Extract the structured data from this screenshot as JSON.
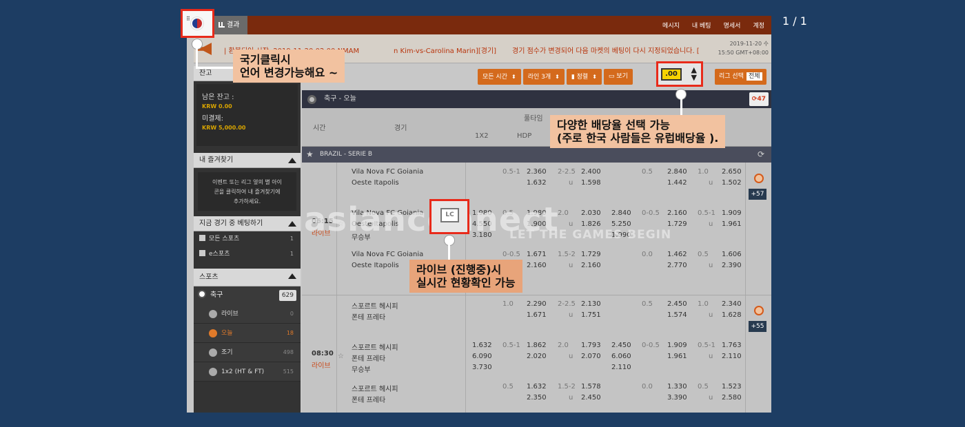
{
  "page_counter": "1 / 1",
  "topbar": {
    "results_tab": "결과",
    "nav": [
      "메시지",
      "내 베팅",
      "명세서",
      "계정"
    ]
  },
  "news": {
    "left": "| 환불되어 시작..2019-11-20 02:00 NMAM",
    "mid": "n Kim-vs-Carolina Marin][경기]",
    "right": "경기 점수가 변경되어 다음 마켓의 베팅이 다시 지정되었습니다. [",
    "date1": "2019-11-20 수",
    "date2": "15:50 GMT+08:00"
  },
  "sidebar": {
    "balance_header": "잔고",
    "balance_label": "남은 잔고 :",
    "balance_value": "KRW 0.00",
    "unsettled_label": "미결제:",
    "unsettled_value": "KRW 5,000.00",
    "fav_header": "내 즐겨찾기",
    "fav_text": [
      "이벤트 또는 리그 옆의 별 아이",
      "콘을 클릭하여 내 즐겨찾기에",
      "추가하세요."
    ],
    "live_header": "지금 경기 중 베팅하기",
    "live_items": [
      {
        "label": "모든 스포츠",
        "count": "1"
      },
      {
        "label": "e스포츠",
        "count": "1"
      }
    ],
    "sports_header": "스포츠",
    "sport": {
      "label": "축구",
      "count": "629"
    },
    "subs": [
      {
        "label": "라이브",
        "count": "0",
        "active": false
      },
      {
        "label": "오늘",
        "count": "18",
        "active": true
      },
      {
        "label": "조기",
        "count": "498",
        "active": false
      },
      {
        "label": "1x2 (HT & FT)",
        "count": "515",
        "active": false
      }
    ]
  },
  "toolbar": {
    "all_time": "모든 시간",
    "lines": "라인 3개",
    "sort": "정렬",
    "view": "보기",
    "odds_value": ".00",
    "league_select": "리그 선택",
    "league_all": "전체"
  },
  "main": {
    "title": "축구 - 오늘",
    "refresh_count": "47",
    "col_time": "시간",
    "col_match": "경기",
    "col_fulltime": "풀타임",
    "col_1x2": "1X2",
    "col_hdp": "HDP",
    "league": "BRAZIL - SERIE B"
  },
  "matches": [
    {
      "time": "06:15",
      "status": "라이브",
      "plus": "+57",
      "rows": [
        {
          "home": "Vila Nova FC Goiania",
          "away": "Oeste Itapolis",
          "draw": "",
          "x": [
            "",
            "",
            ""
          ],
          "hdp": "0.5-1",
          "hdp_odds": [
            "2.360",
            "1.632"
          ],
          "ou": "2-2.5",
          "ou_u": "u",
          "ou_odds": [
            "2.400",
            "1.598"
          ],
          "h_hdp": "0.5",
          "h_hdp_odds": [
            "2.840",
            "1.442"
          ],
          "h_ou": "1.0",
          "h_ou_u": "u",
          "h_ou_odds": [
            "2.650",
            "1.502"
          ],
          "hx": [
            "",
            "",
            ""
          ]
        },
        {
          "home": "Vila Nova FC Goiania",
          "away": "Oeste Itapolis",
          "draw": "무승부",
          "x": [
            "1.980",
            "4.550",
            "3.180"
          ],
          "hdp": "0.5",
          "hdp_odds": [
            "1.980",
            "1.900"
          ],
          "ou": "2.0",
          "ou_u": "u",
          "ou_odds": [
            "2.030",
            "1.826"
          ],
          "h_hdp": "0-0.5",
          "h_hdp_odds": [
            "2.160",
            "1.729"
          ],
          "h_ou": "0.5-1",
          "h_ou_u": "u",
          "h_ou_odds": [
            "1.909",
            "1.961"
          ],
          "hx": [
            "2.840",
            "5.250",
            "1.990"
          ]
        },
        {
          "home": "Vila Nova FC Goiania",
          "away": "Oeste Itapolis",
          "draw": "",
          "x": [
            "",
            "",
            ""
          ],
          "hdp": "0-0.5",
          "hdp_odds": [
            "1.671",
            "2.160"
          ],
          "ou": "1.5-2",
          "ou_u": "u",
          "ou_odds": [
            "1.729",
            "2.160"
          ],
          "h_hdp": "0.0",
          "h_hdp_odds": [
            "1.462",
            "2.770"
          ],
          "h_ou": "0.5",
          "h_ou_u": "u",
          "h_ou_odds": [
            "1.606",
            "2.390"
          ],
          "hx": [
            "",
            "",
            ""
          ]
        }
      ]
    },
    {
      "time": "08:30",
      "status": "라이브",
      "plus": "+55",
      "rows": [
        {
          "home": "스포르트 헤시피",
          "away": "폰테 프레타",
          "draw": "",
          "x": [
            "",
            "",
            ""
          ],
          "hdp": "1.0",
          "hdp_odds": [
            "2.290",
            "1.671"
          ],
          "ou": "2-2.5",
          "ou_u": "u",
          "ou_odds": [
            "2.130",
            "1.751"
          ],
          "h_hdp": "0.5",
          "h_hdp_odds": [
            "2.450",
            "1.574"
          ],
          "h_ou": "1.0",
          "h_ou_u": "u",
          "h_ou_odds": [
            "2.340",
            "1.628"
          ],
          "hx": [
            "",
            "",
            ""
          ]
        },
        {
          "home": "스포르트 헤시피",
          "away": "폰테 프레타",
          "draw": "무승부",
          "x": [
            "1.632",
            "6.090",
            "3.730"
          ],
          "hdp": "0.5-1",
          "hdp_odds": [
            "1.862",
            "2.020"
          ],
          "ou": "2.0",
          "ou_u": "u",
          "ou_odds": [
            "1.793",
            "2.070"
          ],
          "h_hdp": "0-0.5",
          "h_hdp_odds": [
            "1.909",
            "1.961"
          ],
          "h_ou": "0.5-1",
          "h_ou_u": "u",
          "h_ou_odds": [
            "1.763",
            "2.110"
          ],
          "hx": [
            "2.450",
            "6.060",
            "2.110"
          ]
        },
        {
          "home": "스포르트 헤시피",
          "away": "폰테 프레타",
          "draw": "",
          "x": [
            "",
            "",
            ""
          ],
          "hdp": "0.5",
          "hdp_odds": [
            "1.632",
            "2.350"
          ],
          "ou": "1.5-2",
          "ou_u": "u",
          "ou_odds": [
            "1.578",
            "2.450"
          ],
          "h_hdp": "0.0",
          "h_hdp_odds": [
            "1.330",
            "3.390"
          ],
          "h_ou": "0.5",
          "h_ou_u": "u",
          "h_ou_odds": [
            "1.523",
            "2.580"
          ],
          "hx": [
            "",
            "",
            ""
          ]
        }
      ]
    }
  ],
  "watermark": {
    "brand": "asianconnect",
    "tagline": "LET THE GAMES BEGIN"
  },
  "lc_label": "LC",
  "annotations": {
    "flag": [
      "국기클릭시",
      "언어 변경가능해요 ~"
    ],
    "odds": [
      "다양한 배당율 선택 가능",
      "(주로 한국 사람들은 유럽배당율 )."
    ],
    "live": [
      "라이브 (진행중)시",
      "실시간 현황확인 가능"
    ]
  },
  "colors": {
    "background": "#1d3d63",
    "accent": "#d46a1c",
    "highlight": "#e82a1a",
    "callout": "#f2c2a0"
  }
}
